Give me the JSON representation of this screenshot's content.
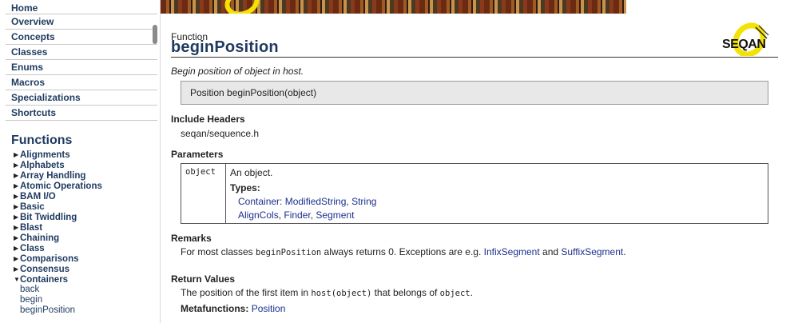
{
  "sidebar": {
    "nav": [
      "Home",
      "Overview",
      "Concepts",
      "Classes",
      "Enums",
      "Macros",
      "Specializations",
      "Shortcuts"
    ],
    "section_title": "Functions",
    "categories": [
      "Alignments",
      "Alphabets",
      "Array Handling",
      "Atomic Operations",
      "BAM I/O",
      "Basic",
      "Bit Twiddling",
      "Blast",
      "Chaining",
      "Class",
      "Comparisons",
      "Consensus",
      "Containers"
    ],
    "expanded_category": "Containers",
    "sub_items": [
      "back",
      "begin",
      "beginPosition"
    ]
  },
  "header": {
    "kind": "Function",
    "title": "beginPosition",
    "logo_text": "SEQAN"
  },
  "summary": "Begin position of object in host.",
  "signature": "Position beginPosition(object)",
  "include": {
    "heading": "Include Headers",
    "value": "seqan/sequence.h"
  },
  "parameters": {
    "heading": "Parameters",
    "name": "object",
    "description": "An object.",
    "types_label": "Types:",
    "types_line1": {
      "link1": "Container",
      "sep1": ": ",
      "link2": "ModifiedString",
      "sep2": ", ",
      "link3": "String"
    },
    "types_line2": {
      "link1": "AlignCols",
      "sep1": ", ",
      "link2": "Finder",
      "sep2": ", ",
      "link3": "Segment"
    }
  },
  "remarks": {
    "heading": "Remarks",
    "text_before": "For most classes ",
    "code": "beginPosition",
    "text_mid": " always returns 0. Exceptions are e.g. ",
    "link1": "InfixSegment",
    "text_and": " and ",
    "link2": "SuffixSegment",
    "text_end": "."
  },
  "return_values": {
    "heading": "Return Values",
    "text_before": "The position of the first item in ",
    "code1": "host(object)",
    "text_mid": " that belongs of ",
    "code2": "object",
    "text_end": ".",
    "metafunctions_label": "Metafunctions:",
    "metafunctions_link": "Position"
  },
  "colors": {
    "nav_text": "#1e3a5f",
    "link": "#1c2f8f",
    "logo_yellow": "#f2e205"
  }
}
